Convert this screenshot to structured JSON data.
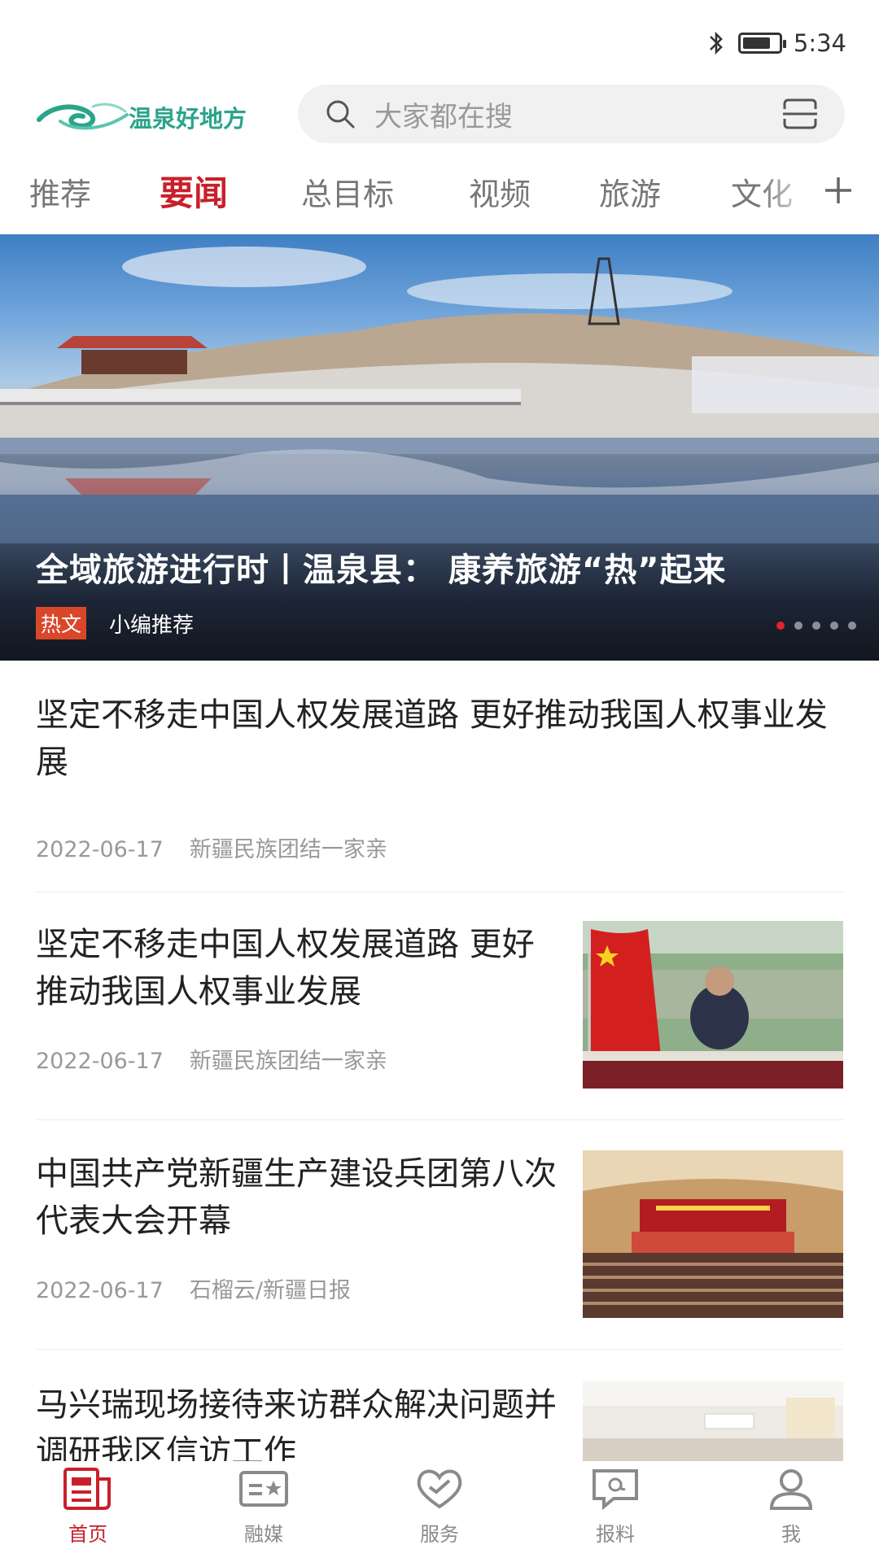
{
  "status_bar": {
    "time": "5:34",
    "icons": [
      "bluetooth-icon",
      "battery-icon"
    ]
  },
  "header": {
    "logo_text": "温泉好地方",
    "search_placeholder": "大家都在搜",
    "search_icon": "search-icon",
    "scan_icon": "scan-icon"
  },
  "tabs": [
    {
      "label": "推荐",
      "active": false
    },
    {
      "label": "要闻",
      "active": true
    },
    {
      "label": "总目标",
      "active": false
    },
    {
      "label": "视频",
      "active": false
    },
    {
      "label": "旅游",
      "active": false
    },
    {
      "label": "文化",
      "active": false
    }
  ],
  "tab_add_icon": "plus-icon",
  "banner": {
    "title": "全域旅游进行时丨温泉县： 康养旅游“热”起来",
    "badge": "热文",
    "source": "小编推荐",
    "dots_count": 5,
    "active_dot": 0
  },
  "news": [
    {
      "title": "坚定不移走中国人权发展道路 更好推动我国人权事业发展",
      "date": "2022-06-17",
      "source": "新疆民族团结一家亲",
      "has_image": false
    },
    {
      "title": "坚定不移走中国人权发展道路 更好推动我国人权事业发展",
      "date": "2022-06-17",
      "source": "新疆民族团结一家亲",
      "has_image": true
    },
    {
      "title": "中国共产党新疆生产建设兵团第八次代表大会开幕",
      "date": "2022-06-17",
      "source": "石榴云/新疆日报",
      "has_image": true
    },
    {
      "title": "马兴瑞现场接待来访群众解决问题并调研我区信访工作",
      "date": "",
      "source": "",
      "has_image": true
    }
  ],
  "bottom_nav": [
    {
      "label": "首页",
      "icon": "news-icon",
      "active": true
    },
    {
      "label": "融媒",
      "icon": "media-icon",
      "active": false
    },
    {
      "label": "服务",
      "icon": "heart-icon",
      "active": false
    },
    {
      "label": "报料",
      "icon": "report-icon",
      "active": false
    },
    {
      "label": "我",
      "icon": "user-icon",
      "active": false
    }
  ],
  "colors": {
    "accent": "#c8202b",
    "logo": "#2aa48a",
    "badge": "#d9472b"
  }
}
